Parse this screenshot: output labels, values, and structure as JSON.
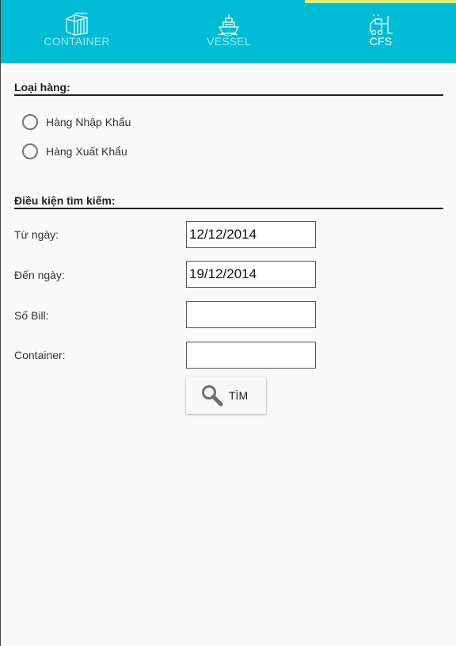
{
  "tabs": [
    {
      "label": "CONTAINER",
      "icon": "container-icon",
      "active": false
    },
    {
      "label": "VESSEL",
      "icon": "vessel-icon",
      "active": false
    },
    {
      "label": "CFS",
      "icon": "forklift-icon",
      "active": true
    }
  ],
  "colors": {
    "accent": "#00bcd4",
    "indicator": "#e6ef7a"
  },
  "cargo_type": {
    "title": "Loại hàng:",
    "options": [
      "Hàng Nhập Khẩu",
      "Hàng Xuất Khẩu"
    ]
  },
  "search": {
    "title": "Điều kiện tìm kiếm:",
    "from_date_label": "Từ ngày:",
    "from_date_value": "12/12/2014",
    "to_date_label": "Đến ngày:",
    "to_date_value": "19/12/2014",
    "bill_label": "Số Bill:",
    "bill_value": "",
    "container_label": "Container:",
    "container_value": "",
    "button_label": "TÌM",
    "button_icon": "search-icon"
  }
}
